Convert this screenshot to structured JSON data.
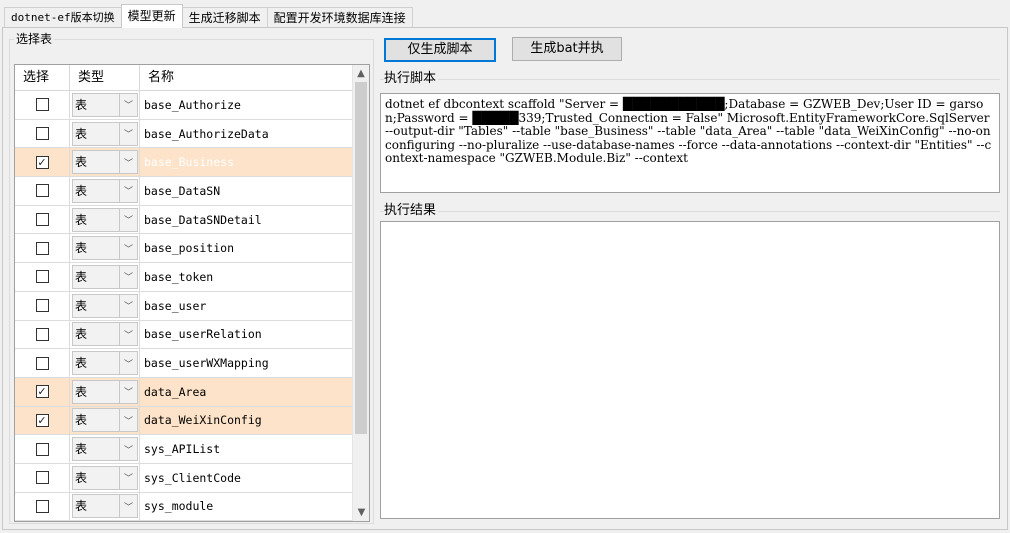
{
  "tabs": [
    {
      "label": "dotnet-ef版本切换",
      "active": false
    },
    {
      "label": "模型更新",
      "active": true
    },
    {
      "label": "生成迁移脚本",
      "active": false
    },
    {
      "label": "配置开发环境数据库连接",
      "active": false
    }
  ],
  "left_group": {
    "title": "选择表",
    "headers": {
      "select": "选择",
      "type": "类型",
      "name": "名称"
    },
    "rows": [
      {
        "checked": false,
        "type": "表",
        "name": "base_Authorize"
      },
      {
        "checked": false,
        "type": "表",
        "name": "base_AuthorizeData"
      },
      {
        "checked": true,
        "type": "表",
        "name": "base_Business"
      },
      {
        "checked": false,
        "type": "表",
        "name": "base_DataSN"
      },
      {
        "checked": false,
        "type": "表",
        "name": "base_DataSNDetail"
      },
      {
        "checked": false,
        "type": "表",
        "name": "base_position"
      },
      {
        "checked": false,
        "type": "表",
        "name": "base_token"
      },
      {
        "checked": false,
        "type": "表",
        "name": "base_user"
      },
      {
        "checked": false,
        "type": "表",
        "name": "base_userRelation"
      },
      {
        "checked": false,
        "type": "表",
        "name": "base_userWXMapping"
      },
      {
        "checked": true,
        "type": "表",
        "name": "data_Area"
      },
      {
        "checked": true,
        "type": "表",
        "name": "data_WeiXinConfig"
      },
      {
        "checked": false,
        "type": "表",
        "name": "sys_APIList"
      },
      {
        "checked": false,
        "type": "表",
        "name": "sys_ClientCode"
      },
      {
        "checked": false,
        "type": "表",
        "name": "sys_module"
      },
      {
        "checked": false,
        "type": "表",
        "name": ""
      }
    ]
  },
  "buttons": {
    "generate_script": "仅生成脚本",
    "generate_bat": "生成bat并执"
  },
  "script_section": {
    "label": "执行脚本",
    "text": "dotnet ef dbcontext scaffold \"Server = ███████████;Database = GZWEB_Dev;User ID = garson;Password = █████339;Trusted_Connection = False\" Microsoft.EntityFrameworkCore.SqlServer --output-dir \"Tables\" --table \"base_Business\" --table \"data_Area\" --table \"data_WeiXinConfig\" --no-onconfiguring --no-pluralize --use-database-names --force --data-annotations --context-dir \"Entities\" --context-namespace \"GZWEB.Module.Biz\" --context"
  },
  "result_section": {
    "label": "执行结果",
    "text": ""
  },
  "colors": {
    "selected_row": "#fde3c9",
    "primary_border": "#0078d7"
  }
}
